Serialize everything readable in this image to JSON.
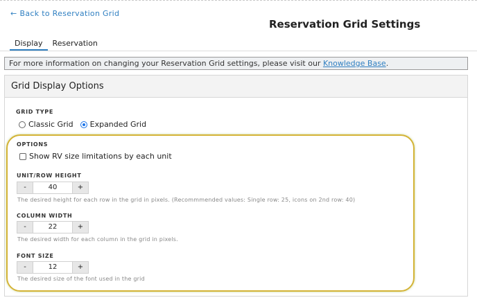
{
  "nav": {
    "back_label": "Back to Reservation Grid"
  },
  "page": {
    "title": "Reservation Grid Settings"
  },
  "tabs": [
    {
      "label": "Display",
      "active": true
    },
    {
      "label": "Reservation",
      "active": false
    }
  ],
  "info": {
    "text": "For more information on changing your Reservation Grid settings, please visit our ",
    "link_label": "Knowledge Base",
    "suffix": "."
  },
  "panel": {
    "title": "Grid Display Options",
    "grid_type": {
      "label": "GRID TYPE",
      "options": [
        {
          "label": "Classic Grid",
          "checked": false
        },
        {
          "label": "Expanded Grid",
          "checked": true
        }
      ]
    },
    "options": {
      "label": "OPTIONS",
      "show_rv_label": "Show RV size limitations by each unit",
      "show_rv_checked": false
    },
    "unit_row_height": {
      "label": "UNIT/ROW HEIGHT",
      "value": "40",
      "minus": "-",
      "plus": "+",
      "help": "The desired height for each row in the grid in pixels. (Recommmended values: Single row: 25, icons on 2nd row: 40)"
    },
    "column_width": {
      "label": "COLUMN WIDTH",
      "value": "22",
      "minus": "-",
      "plus": "+",
      "help": "The desired width for each column in the grid in pixels."
    },
    "font_size": {
      "label": "FONT SIZE",
      "value": "12",
      "minus": "-",
      "plus": "+",
      "help": "The desired size of the font used in the grid"
    }
  },
  "colors": {
    "link": "#2f7fc1",
    "highlight_border": "#d4b336",
    "radio_selected": "#1a73e8"
  },
  "icons": {
    "back": "arrow-left-icon"
  }
}
